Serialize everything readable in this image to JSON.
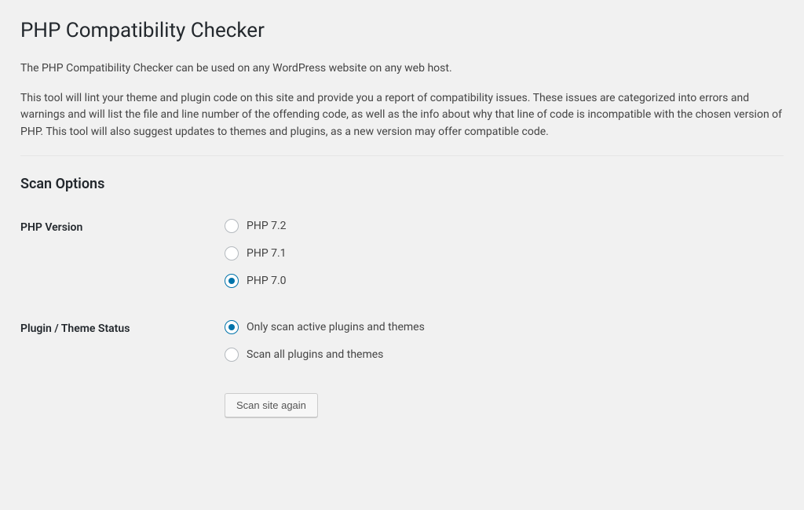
{
  "page": {
    "title": "PHP Compatibility Checker",
    "intro1": "The PHP Compatibility Checker can be used on any WordPress website on any web host.",
    "intro2": "This tool will lint your theme and plugin code on this site and provide you a report of compatibility issues. These issues are categorized into errors and warnings and will list the file and line number of the offending code, as well as the info about why that line of code is incompatible with the chosen version of PHP. This tool will also suggest updates to themes and plugins, as a new version may offer compatible code."
  },
  "scanOptions": {
    "heading": "Scan Options",
    "phpVersion": {
      "label": "PHP Version",
      "options": [
        {
          "label": "PHP 7.2",
          "checked": false
        },
        {
          "label": "PHP 7.1",
          "checked": false
        },
        {
          "label": "PHP 7.0",
          "checked": true
        }
      ]
    },
    "pluginThemeStatus": {
      "label": "Plugin / Theme Status",
      "options": [
        {
          "label": "Only scan active plugins and themes",
          "checked": true
        },
        {
          "label": "Scan all plugins and themes",
          "checked": false
        }
      ]
    },
    "submitLabel": "Scan site again"
  }
}
